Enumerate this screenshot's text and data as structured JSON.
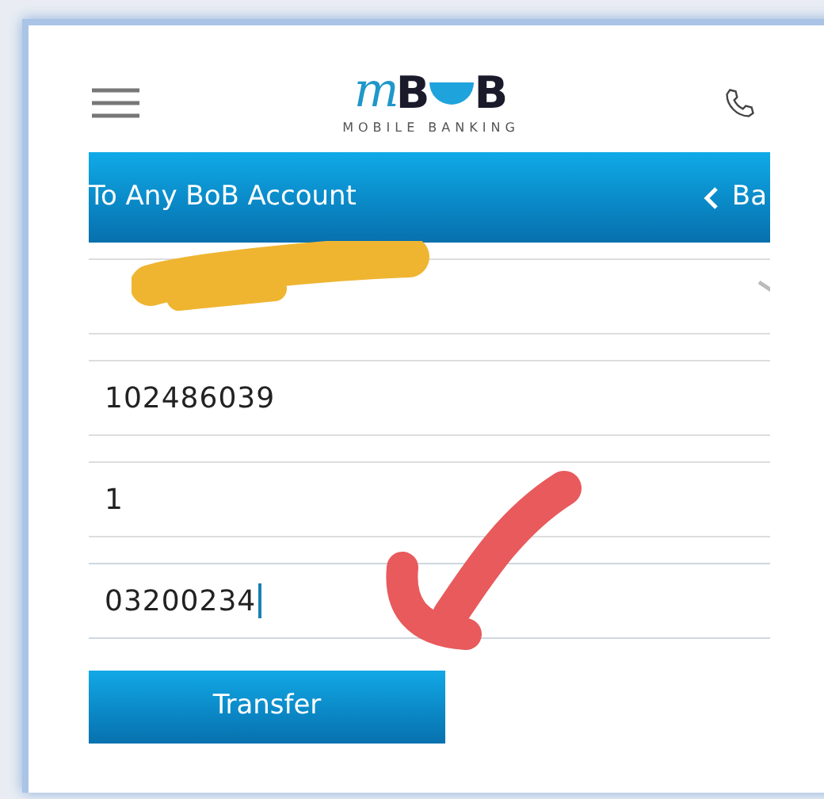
{
  "header": {
    "logo_letters": [
      "m",
      "B",
      "B"
    ],
    "logo_tagline": "MOBILE BANKING"
  },
  "title_bar": {
    "title": "To Any BoB Account",
    "back_label": "Ba"
  },
  "fields": [
    {
      "kind": "select"
    },
    {
      "kind": "text",
      "value": "102486039",
      "focused": false
    },
    {
      "kind": "text",
      "value": "1",
      "focused": false
    },
    {
      "kind": "text",
      "value": "03200234",
      "focused": true
    }
  ],
  "submit": {
    "label": "Transfer"
  }
}
